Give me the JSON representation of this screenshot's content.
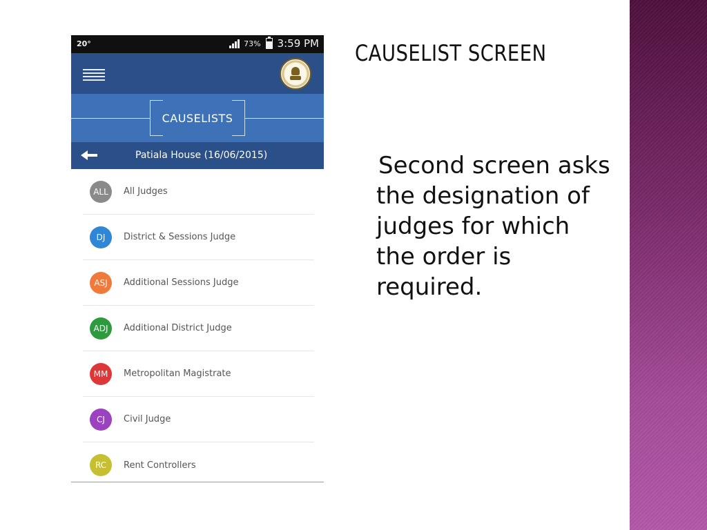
{
  "slide": {
    "title": "CAUSELIST SCREEN",
    "body": "Second screen asks the designation of judges for which the order is required."
  },
  "phone": {
    "status_bar": {
      "temperature": "20°",
      "battery": "73%",
      "time": "3:59 PM"
    },
    "app_bar": {
      "menu_icon": "hamburger-icon",
      "logo_icon": "district-court-emblem"
    },
    "section_title": "CAUSELISTS",
    "sub_bar": {
      "back_icon": "back-arrow-icon",
      "title": "Patiala House (16/06/2015)"
    },
    "judges": [
      {
        "abbr": "ALL",
        "label": "All Judges",
        "color": "#8a8a8a"
      },
      {
        "abbr": "DJ",
        "label": "District & Sessions Judge",
        "color": "#2f86d6"
      },
      {
        "abbr": "ASJ",
        "label": "Additional Sessions Judge",
        "color": "#f07a3c"
      },
      {
        "abbr": "ADJ",
        "label": "Additional District Judge",
        "color": "#2e9a3e"
      },
      {
        "abbr": "MM",
        "label": "Metropolitan Magistrate",
        "color": "#dd3838"
      },
      {
        "abbr": "CJ",
        "label": "Civil Judge",
        "color": "#9b42c0"
      },
      {
        "abbr": "RC",
        "label": "Rent Controllers",
        "color": "#c6bf32"
      }
    ]
  },
  "theme": {
    "app_bar_color": "#2b4f88",
    "section_band_color": "#3d72b9",
    "side_band_color": "#8a3a7c"
  }
}
